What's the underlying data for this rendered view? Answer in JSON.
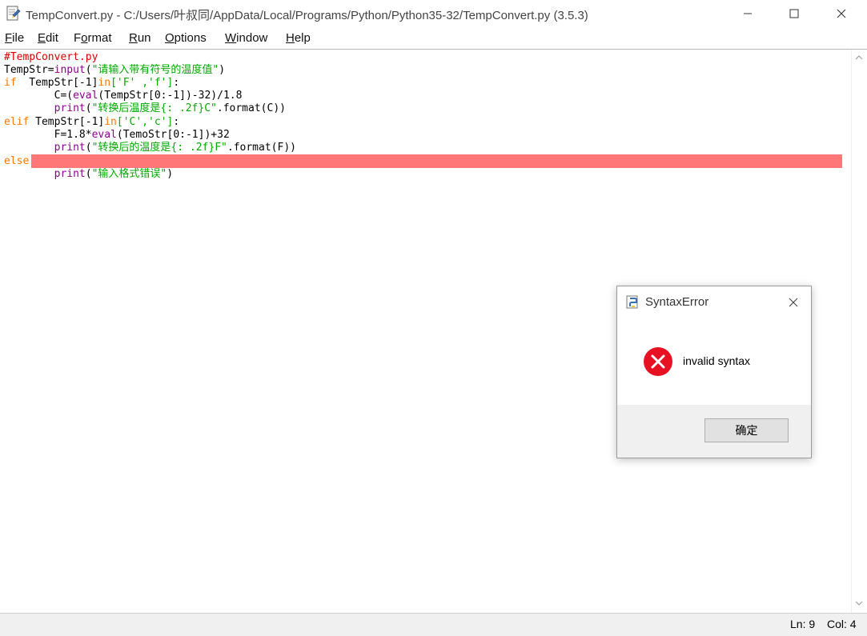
{
  "window": {
    "title": "TempConvert.py - C:/Users/叶叔同/AppData/Local/Programs/Python/Python35-32/TempConvert.py (3.5.3)",
    "minimize_icon": "minimize-icon",
    "maximize_icon": "maximize-icon",
    "close_icon": "close-icon"
  },
  "menu": [
    {
      "mn": "F",
      "rest": "ile"
    },
    {
      "mn": "E",
      "rest": "dit"
    },
    {
      "pre": "F",
      "mn": "o",
      "rest": "rmat"
    },
    {
      "mn": "R",
      "rest": "un"
    },
    {
      "mn": "O",
      "rest": "ptions"
    },
    {
      "mn": "W",
      "rest": "indow"
    },
    {
      "mn": "H",
      "rest": "elp"
    }
  ],
  "code": {
    "l1": "#TempConvert.py",
    "l2": {
      "a": "TempStr=",
      "b": "input",
      "c": "(",
      "d": "\"请输入带有符号的温度值\"",
      "e": ")"
    },
    "l3": {
      "a": "if",
      "b": "  TempStr[-1]",
      "c": "in",
      "d": "['F' ,'f']",
      "e": ":"
    },
    "l4": {
      "a": "        C=(",
      "b": "eval",
      "c": "(TempStr[0:-1])-32)/1.8"
    },
    "l5": {
      "a": "        ",
      "b": "print",
      "c": "(",
      "d": "\"转换后温度是{: .2f}C\"",
      "e": ".format(C))"
    },
    "l6": {
      "a": "elif",
      "b": " TempStr[-1]",
      "c": "in",
      "d": "['C','c']",
      "e": ":"
    },
    "l7": {
      "a": "        F=1.8*",
      "b": "eval",
      "c": "(TemoStr[0:-1])+32"
    },
    "l8": {
      "a": "        ",
      "b": "print",
      "c": "(",
      "d": "\"转换后的温度是{: .2f}F\"",
      "e": ".format(F))"
    },
    "l9": "else",
    "l10": {
      "a": "        ",
      "b": "print",
      "c": "(",
      "d": "\"输入格式错误\"",
      "e": ")"
    }
  },
  "status": {
    "ln": "Ln: 9",
    "col": "Col: 4"
  },
  "dialog": {
    "title": "SyntaxError",
    "message": "invalid syntax",
    "ok_label": "确定",
    "error_icon": "error-icon"
  },
  "colors": {
    "comment": "#dd0000",
    "keyword": "#ff7700",
    "builtin": "#900090",
    "string": "#00aa00",
    "error_highlight": "#ff7777",
    "error_icon": "#e81123"
  }
}
